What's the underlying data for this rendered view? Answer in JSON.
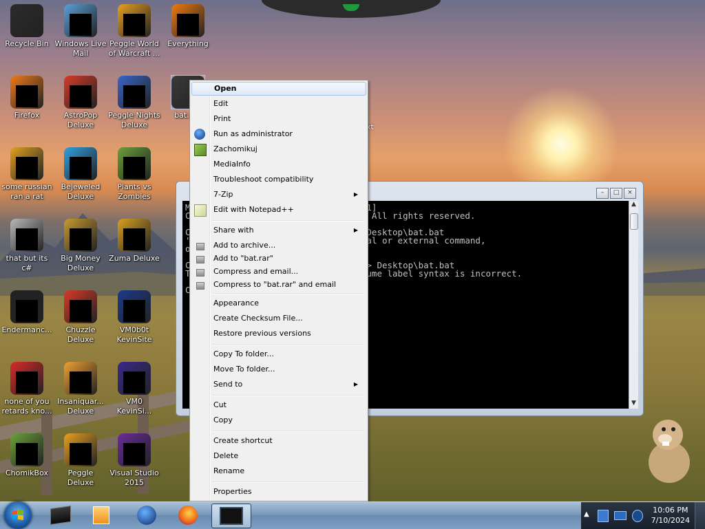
{
  "desktop": {
    "icons": [
      {
        "label": "Recycle Bin",
        "icon": "recycle-bin-icon",
        "color": "#2b2b2b",
        "col": 0,
        "row": 0,
        "redacted": false
      },
      {
        "label": "Windows Live Mail",
        "icon": "mail-icon",
        "color": "#5aa0d8",
        "col": 1,
        "row": 0,
        "redacted": true
      },
      {
        "label": "Peggle World of Warcraft ...",
        "icon": "peggle-icon",
        "color": "#e8a020",
        "col": 2,
        "row": 0,
        "redacted": true
      },
      {
        "label": "Everything",
        "icon": "everything-icon",
        "color": "#f07a10",
        "col": 3,
        "row": 0,
        "redacted": true
      },
      {
        "label": "Firefox",
        "icon": "firefox-icon",
        "color": "#f07a1a",
        "col": 0,
        "row": 1,
        "redacted": true
      },
      {
        "label": "AstroPop Deluxe",
        "icon": "astropop-icon",
        "color": "#d83a2a",
        "col": 1,
        "row": 1,
        "redacted": true
      },
      {
        "label": "Peggle Nights Deluxe",
        "icon": "peggle-nights-icon",
        "color": "#3a64c8",
        "col": 2,
        "row": 1,
        "redacted": true
      },
      {
        "label": "bat.bat",
        "icon": "batch-file-icon",
        "color": "#3a3a3a",
        "col": 3,
        "row": 1,
        "redacted": false,
        "selected": true
      },
      {
        "label": "some russian ran a rat",
        "icon": "java-file-icon",
        "color": "#e0a020",
        "col": 0,
        "row": 2,
        "redacted": true
      },
      {
        "label": "Bejeweled Deluxe",
        "icon": "bejeweled-icon",
        "color": "#30a0e0",
        "col": 1,
        "row": 2,
        "redacted": true
      },
      {
        "label": "Plants vs Zombies",
        "icon": "pvz-icon",
        "color": "#6aa03a",
        "col": 2,
        "row": 2,
        "redacted": true
      },
      {
        "label": "that but its c#",
        "icon": "files-icon",
        "color": "#b8b8b8",
        "col": 0,
        "row": 3,
        "redacted": true
      },
      {
        "label": "Big Money Deluxe",
        "icon": "money-icon",
        "color": "#c89a30",
        "col": 1,
        "row": 3,
        "redacted": true
      },
      {
        "label": "Zuma Deluxe",
        "icon": "zuma-icon",
        "color": "#d8a020",
        "col": 2,
        "row": 3,
        "redacted": true
      },
      {
        "label": "Endermanc...",
        "icon": "enderman-icon",
        "color": "#222222",
        "col": 0,
        "row": 4,
        "redacted": true
      },
      {
        "label": "Chuzzle Deluxe",
        "icon": "chuzzle-icon",
        "color": "#d83a2a",
        "col": 1,
        "row": 4,
        "redacted": true
      },
      {
        "label": "VM0b0t KevinSite",
        "icon": "vm-icon",
        "color": "#1a3a8a",
        "col": 2,
        "row": 4,
        "redacted": true
      },
      {
        "label": "none of you retards kno...",
        "icon": "opera-icon",
        "color": "#d82a2a",
        "col": 0,
        "row": 5,
        "redacted": true
      },
      {
        "label": "Insaniquar... Deluxe",
        "icon": "insaniquarium-icon",
        "color": "#f0a030",
        "col": 1,
        "row": 5,
        "redacted": true
      },
      {
        "label": "VM0 KevinSi...",
        "icon": "vm-icon",
        "color": "#3a2a8a",
        "col": 2,
        "row": 5,
        "redacted": true
      },
      {
        "label": "ChomikBox",
        "icon": "chomikbox-icon",
        "color": "#6aa03a",
        "col": 0,
        "row": 6,
        "redacted": true
      },
      {
        "label": "Peggle Deluxe",
        "icon": "peggle-icon",
        "color": "#e8a020",
        "col": 1,
        "row": 6,
        "redacted": true
      },
      {
        "label": "Visual Studio 2015",
        "icon": "visual-studio-icon",
        "color": "#6a2a9a",
        "col": 2,
        "row": 6,
        "redacted": true
      }
    ],
    "behind_label": "xt"
  },
  "console": {
    "buttons": {
      "minimize": "–",
      "maximize": "□",
      "close": "×"
    },
    "lines": [
      "M                                 01]",
      "C                                .  All rights reserved.",
      "",
      "C                                > Desktop\\bat.bat",
      "'                                rnal or external command,",
      "o",
      "",
      "C                                ' > Desktop\\bat.bat",
      "T                                olume label syntax is incorrect.",
      "",
      "C"
    ]
  },
  "context_menu": {
    "items": [
      {
        "label": "Open",
        "bold": true,
        "highlight": true,
        "icon": null,
        "submenu": false,
        "y": 0
      },
      {
        "label": "Edit",
        "icon": null,
        "submenu": false
      },
      {
        "label": "Print",
        "icon": null,
        "submenu": false
      },
      {
        "label": "Run as administrator",
        "icon": "shield-icon",
        "submenu": false
      },
      {
        "label": "Zachomikuj",
        "icon": "chomikbox-icon",
        "submenu": false
      },
      {
        "label": "MediaInfo",
        "icon": null,
        "submenu": false
      },
      {
        "label": "Troubleshoot compatibility",
        "icon": null,
        "submenu": false
      },
      {
        "label": "7-Zip",
        "icon": null,
        "submenu": true
      },
      {
        "label": "Edit with Notepad++",
        "icon": "notepad-plus-icon",
        "submenu": false
      },
      {
        "sep": true
      },
      {
        "label": "Share with",
        "icon": null,
        "submenu": true
      },
      {
        "label": "Add to archive...",
        "icon": "winrar-icon",
        "submenu": false
      },
      {
        "label": "Add to \"bat.rar\"",
        "icon": "winrar-icon",
        "submenu": false
      },
      {
        "label": "Compress and email...",
        "icon": "winrar-icon",
        "submenu": false
      },
      {
        "label": "Compress to \"bat.rar\" and email",
        "icon": "winrar-icon",
        "submenu": false
      },
      {
        "sep": true
      },
      {
        "label": "Appearance",
        "icon": null,
        "submenu": false
      },
      {
        "label": "Create Checksum File...",
        "icon": null,
        "submenu": false
      },
      {
        "label": "Restore previous versions",
        "icon": null,
        "submenu": false
      },
      {
        "sep": true
      },
      {
        "label": "Copy To folder...",
        "icon": null,
        "submenu": false
      },
      {
        "label": "Move To folder...",
        "icon": null,
        "submenu": false
      },
      {
        "label": "Send to",
        "icon": null,
        "submenu": true
      },
      {
        "sep": true
      },
      {
        "label": "Cut",
        "icon": null,
        "submenu": false
      },
      {
        "label": "Copy",
        "icon": null,
        "submenu": false
      },
      {
        "sep": true
      },
      {
        "label": "Create shortcut",
        "icon": null,
        "submenu": false
      },
      {
        "label": "Delete",
        "icon": null,
        "submenu": false
      },
      {
        "label": "Rename",
        "icon": null,
        "submenu": false
      },
      {
        "sep": true
      },
      {
        "label": "Properties",
        "icon": null,
        "submenu": false
      }
    ]
  },
  "taskbar": {
    "start_icon": "windows-start-icon",
    "pinned": [
      {
        "name": "cmd-icon",
        "active": false
      },
      {
        "name": "media-player-icon",
        "active": false
      },
      {
        "name": "globe-icon",
        "active": false
      },
      {
        "name": "firefox-icon",
        "active": false
      },
      {
        "name": "console-window-icon",
        "active": true
      }
    ],
    "tray": {
      "expand": "▲",
      "icons": [
        "network-icon",
        "display-icon",
        "volume-icon"
      ],
      "time": "10:06 PM",
      "date": "7/10/2024"
    }
  },
  "colors": {
    "menu_bg": "#f0f0f0",
    "menu_highlight": "#dde9f9",
    "taskbar": "#7b9bbd",
    "console_bg": "#000000"
  }
}
